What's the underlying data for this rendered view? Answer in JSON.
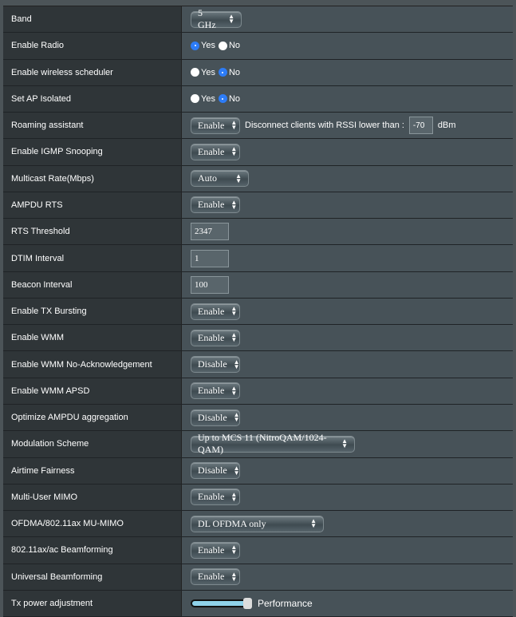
{
  "rows": [
    {
      "label": "Band",
      "type": "select",
      "value": "5 GHz",
      "w": 64
    },
    {
      "label": "Enable Radio",
      "type": "radio",
      "options": [
        "Yes",
        "No"
      ],
      "selected": "Yes"
    },
    {
      "label": "Enable wireless scheduler",
      "type": "radio",
      "options": [
        "Yes",
        "No"
      ],
      "selected": "No"
    },
    {
      "label": "Set AP Isolated",
      "type": "radio",
      "options": [
        "Yes",
        "No"
      ],
      "selected": "No"
    },
    {
      "label": "Roaming assistant",
      "type": "roaming",
      "value": "Enable",
      "text": "Disconnect clients with RSSI lower than :",
      "rssi": "-70",
      "unit": "dBm"
    },
    {
      "label": "Enable IGMP Snooping",
      "type": "select",
      "value": "Enable"
    },
    {
      "label": "Multicast Rate(Mbps)",
      "type": "select",
      "value": "Auto",
      "w": 73
    },
    {
      "label": "AMPDU RTS",
      "type": "select",
      "value": "Enable"
    },
    {
      "label": "RTS Threshold",
      "type": "input",
      "value": "2347"
    },
    {
      "label": "DTIM Interval",
      "type": "input",
      "value": "1"
    },
    {
      "label": "Beacon Interval",
      "type": "input",
      "value": "100"
    },
    {
      "label": "Enable TX Bursting",
      "type": "select",
      "value": "Enable"
    },
    {
      "label": "Enable WMM",
      "type": "select",
      "value": "Enable"
    },
    {
      "label": "Enable WMM No-Acknowledgement",
      "type": "select",
      "value": "Disable"
    },
    {
      "label": "Enable WMM APSD",
      "type": "select",
      "value": "Enable"
    },
    {
      "label": "Optimize AMPDU aggregation",
      "type": "select",
      "value": "Disable"
    },
    {
      "label": "Modulation Scheme",
      "type": "select",
      "value": "Up to MCS 11 (NitroQAM/1024-QAM)",
      "w": 206
    },
    {
      "label": "Airtime Fairness",
      "type": "select",
      "value": "Disable"
    },
    {
      "label": "Multi-User MIMO",
      "type": "select",
      "value": "Enable"
    },
    {
      "label": "OFDMA/802.11ax MU-MIMO",
      "type": "select",
      "value": "DL OFDMA only",
      "w": 167
    },
    {
      "label": "802.11ax/ac Beamforming",
      "type": "select",
      "value": "Enable"
    },
    {
      "label": "Universal Beamforming",
      "type": "select",
      "value": "Enable"
    },
    {
      "label": "Tx power adjustment",
      "type": "slider",
      "value_percent": 100,
      "text": "Performance"
    }
  ]
}
